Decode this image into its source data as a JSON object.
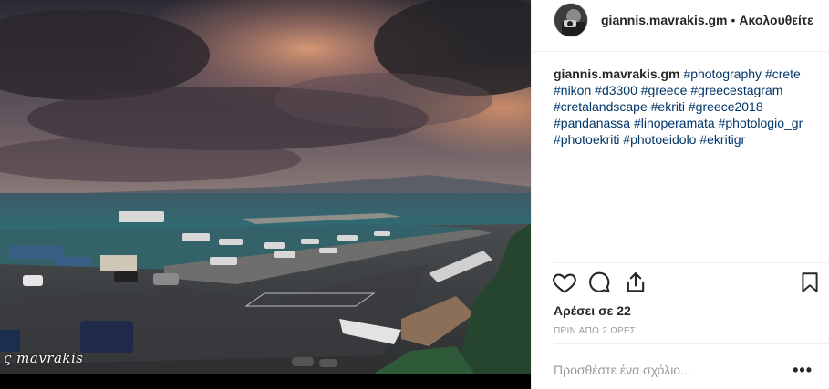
{
  "post": {
    "watermark": "ς mavrakis",
    "image_alt": "Harbour at dusk under cloudy sky"
  },
  "header": {
    "username": "giannis.mavrakis.gm",
    "separator": "•",
    "follow_status": "Ακολουθείτε"
  },
  "caption": {
    "username": "giannis.mavrakis.gm",
    "hashtags": [
      "#photography",
      "#crete",
      "#nikon",
      "#d3300",
      "#greece",
      "#greecestagram",
      "#cretalandscape",
      "#ekriti",
      "#greece2018",
      "#pandanassa",
      "#linoperamata",
      "#photologio_gr",
      "#photoekriti",
      "#photoeidolo",
      "#ekritigr"
    ]
  },
  "actions": {
    "like_icon": "heart-icon",
    "comment_icon": "comment-icon",
    "share_icon": "share-icon",
    "save_icon": "bookmark-icon"
  },
  "stats": {
    "likes": "Αρέσει σε 22",
    "time": "ΠΡΙΝ ΑΠΟ 2 ΩΡΕΣ"
  },
  "comment_box": {
    "placeholder": "Προσθέστε ένα σχόλιο...",
    "more_label": "•••"
  }
}
